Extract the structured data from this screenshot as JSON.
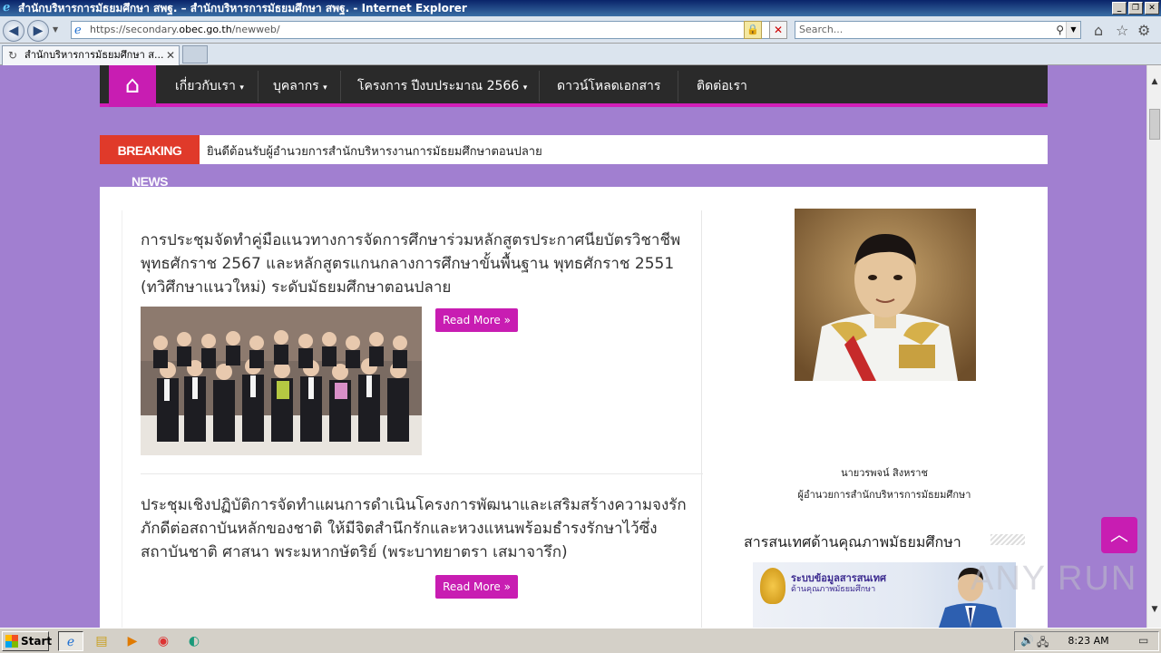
{
  "browser": {
    "window_title": "สำนักบริหารการมัธยมศึกษา สพฐ. – สำนักบริหารการมัธยมศึกษา สพฐ. - Internet Explorer",
    "url_host": "https://secondary.",
    "url_domain": "obec.go.th",
    "url_path": "/newweb/",
    "search_placeholder": "Search...",
    "tab_title": "สำนักบริหารการมัธยมศึกษา ส..."
  },
  "site": {
    "nav": [
      {
        "label": "เกี่ยวกับเรา",
        "dropdown": true
      },
      {
        "label": "บุคลากร",
        "dropdown": true
      },
      {
        "label": "โครงการ  ปีงบประมาณ  2566",
        "dropdown": true
      },
      {
        "label": "ดาวน์โหลดเอกสาร",
        "dropdown": false
      },
      {
        "label": "ติดต่อเรา",
        "dropdown": false
      }
    ],
    "breaking_label": "BREAKING NEWS",
    "breaking_text": "ยินดีต้อนรับผู้อำนวยการสำนักบริหารงานการมัธยมศึกษาตอนปลาย",
    "posts": [
      {
        "title": "การประชุมจัดทำคู่มือแนวทางการจัดการศึกษาร่วมหลักสูตรประกาศนียบัตรวิชาชีพ พุทธศักราช  2567 และหลักสูตรแกนกลางการศึกษาขั้นพื้นฐาน  พุทธศักราช  2551 (ทวิศึกษาแนวใหม่) ระดับมัธยมศึกษาตอนปลาย",
        "read_more": "Read More »"
      },
      {
        "title": "ประชุมเชิงปฏิบัติการจัดทำแผนการดำเนินโครงการพัฒนาและเสริมสร้างความจงรักภักดีต่อสถาบันหลักของชาติ  ให้มีจิตสำนึกรักและหวงแหนพร้อมธำรงรักษาไว้ซึ่งสถาบันชาติ  ศาสนา  พระมหากษัตริย์  (พระบาทยาตรา  เสมาจารึก)",
        "read_more": "Read More »"
      }
    ],
    "sidebar": {
      "director_name": "นายวรพจน์  สิงหราช",
      "director_position": "ผู้อำนวยการสำนักบริหารการมัธยมศึกษา",
      "widget_title": "สารสนเทศด้านคุณภาพมัธยมศึกษา",
      "banner_line1": "ระบบข้อมูลสารสนเทศ",
      "banner_line2": "ด้านคุณภาพมัธยมศึกษา"
    },
    "watermark": "ANY RUN"
  },
  "taskbar": {
    "start_label": "Start",
    "clock": "8:23 AM"
  },
  "colors": {
    "accent": "#c81db2",
    "page_bg": "#a17fd0",
    "navbar": "#2a2a2a",
    "breaking": "#e03a2a"
  }
}
